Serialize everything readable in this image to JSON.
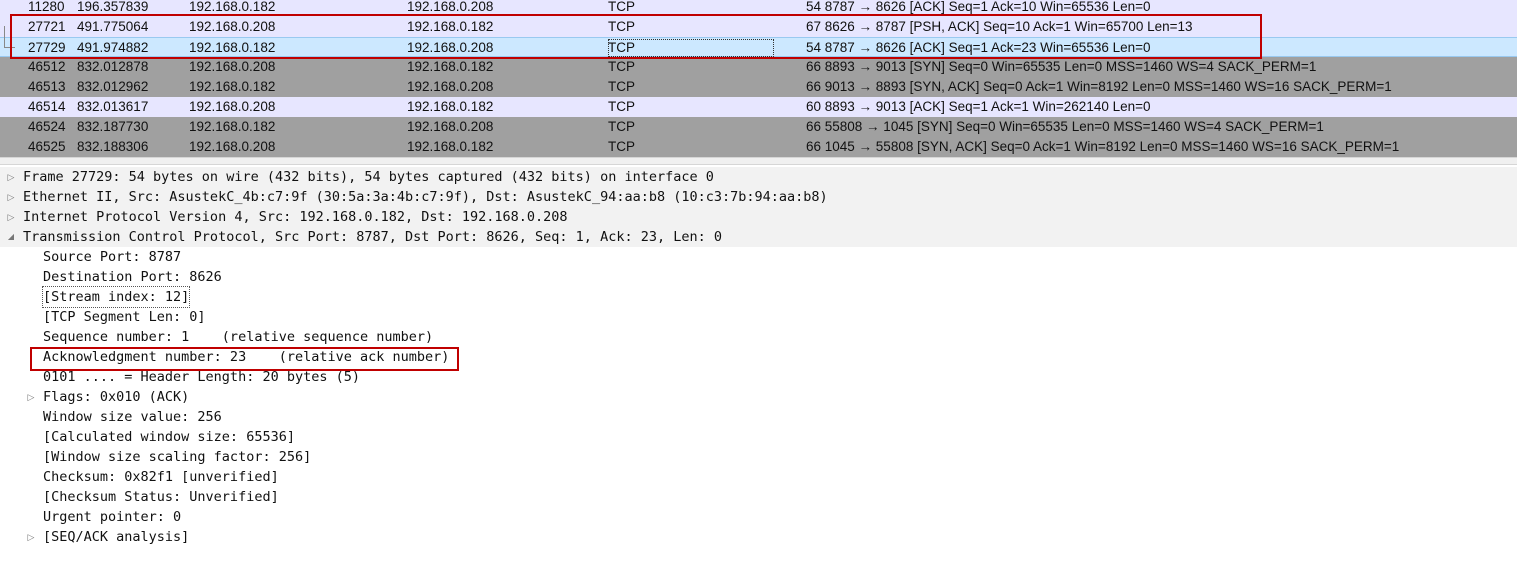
{
  "packet_list": {
    "rows": [
      {
        "no": "11280",
        "time": "196.357839",
        "src": "192.168.0.182",
        "dst": "192.168.0.208",
        "proto": "TCP",
        "info": "54 8787 → 8626 [ACK] Seq=1 Ack=10 Win=65536 Len=0",
        "style": "lav"
      },
      {
        "no": "27721",
        "time": "491.775064",
        "src": "192.168.0.208",
        "dst": "192.168.0.182",
        "proto": "TCP",
        "info": "67 8626 → 8787 [PSH, ACK] Seq=10 Ack=1 Win=65700 Len=13",
        "style": "lav"
      },
      {
        "no": "27729",
        "time": "491.974882",
        "src": "192.168.0.182",
        "dst": "192.168.0.208",
        "proto": "TCP",
        "info": "54 8787 → 8626 [ACK] Seq=1 Ack=23 Win=65536 Len=0",
        "style": "sel"
      },
      {
        "no": "46512",
        "time": "832.012878",
        "src": "192.168.0.208",
        "dst": "192.168.0.182",
        "proto": "TCP",
        "info": "66 8893 → 9013 [SYN] Seq=0 Win=65535 Len=0 MSS=1460 WS=4 SACK_PERM=1",
        "style": "grey"
      },
      {
        "no": "46513",
        "time": "832.012962",
        "src": "192.168.0.182",
        "dst": "192.168.0.208",
        "proto": "TCP",
        "info": "66 9013 → 8893 [SYN, ACK] Seq=0 Ack=1 Win=8192 Len=0 MSS=1460 WS=16 SACK_PERM=1",
        "style": "grey"
      },
      {
        "no": "46514",
        "time": "832.013617",
        "src": "192.168.0.208",
        "dst": "192.168.0.182",
        "proto": "TCP",
        "info": "60 8893 → 9013 [ACK] Seq=1 Ack=1 Win=262140 Len=0",
        "style": "lav"
      },
      {
        "no": "46524",
        "time": "832.187730",
        "src": "192.168.0.182",
        "dst": "192.168.0.208",
        "proto": "TCP",
        "info": "66 55808 → 1045 [SYN] Seq=0 Win=65535 Len=0 MSS=1460 WS=4 SACK_PERM=1",
        "style": "grey"
      },
      {
        "no": "46525",
        "time": "832.188306",
        "src": "192.168.0.208",
        "dst": "192.168.0.182",
        "proto": "TCP",
        "info": "66 1045 → 55808 [SYN, ACK] Seq=0 Ack=1 Win=8192 Len=0 MSS=1460 WS=16 SACK_PERM=1",
        "style": "grey"
      }
    ]
  },
  "detail_tree": {
    "items": [
      {
        "label": "Frame 27729: 54 bytes on wire (432 bits), 54 bytes captured (432 bits) on interface 0",
        "level": 0,
        "twisty": "collapsed"
      },
      {
        "label": "Ethernet II, Src: AsustekC_4b:c7:9f (30:5a:3a:4b:c7:9f), Dst: AsustekC_94:aa:b8 (10:c3:7b:94:aa:b8)",
        "level": 0,
        "twisty": "collapsed"
      },
      {
        "label": "Internet Protocol Version 4, Src: 192.168.0.182, Dst: 192.168.0.208",
        "level": 0,
        "twisty": "collapsed"
      },
      {
        "label": "Transmission Control Protocol, Src Port: 8787, Dst Port: 8626, Seq: 1, Ack: 23, Len: 0",
        "level": 0,
        "twisty": "expanded"
      },
      {
        "label": "Source Port: 8787",
        "level": 1,
        "twisty": ""
      },
      {
        "label": "Destination Port: 8626",
        "level": 1,
        "twisty": ""
      },
      {
        "label": "[Stream index: 12]",
        "level": 1,
        "twisty": "",
        "focus": true
      },
      {
        "label": "[TCP Segment Len: 0]",
        "level": 1,
        "twisty": ""
      },
      {
        "label": "Sequence number: 1    (relative sequence number)",
        "level": 1,
        "twisty": ""
      },
      {
        "label": "Acknowledgment number: 23    (relative ack number)",
        "level": 1,
        "twisty": ""
      },
      {
        "label": "0101 .... = Header Length: 20 bytes (5)",
        "level": 1,
        "twisty": ""
      },
      {
        "label": "Flags: 0x010 (ACK)",
        "level": 1,
        "twisty": "collapsed"
      },
      {
        "label": "Window size value: 256",
        "level": 1,
        "twisty": ""
      },
      {
        "label": "[Calculated window size: 65536]",
        "level": 1,
        "twisty": ""
      },
      {
        "label": "[Window size scaling factor: 256]",
        "level": 1,
        "twisty": ""
      },
      {
        "label": "Checksum: 0x82f1 [unverified]",
        "level": 1,
        "twisty": ""
      },
      {
        "label": "[Checksum Status: Unverified]",
        "level": 1,
        "twisty": ""
      },
      {
        "label": "Urgent pointer: 0",
        "level": 1,
        "twisty": ""
      },
      {
        "label": "[SEQ/ACK analysis]",
        "level": 1,
        "twisty": "collapsed"
      }
    ]
  },
  "colors": {
    "highlight_box": "#c00000",
    "row_grey": "#a0a0a0",
    "row_lavender": "#e7e6ff",
    "row_selected": "#cce8ff"
  },
  "icons": {
    "collapsed": "triangle-right-icon",
    "expanded": "triangle-down-icon"
  }
}
